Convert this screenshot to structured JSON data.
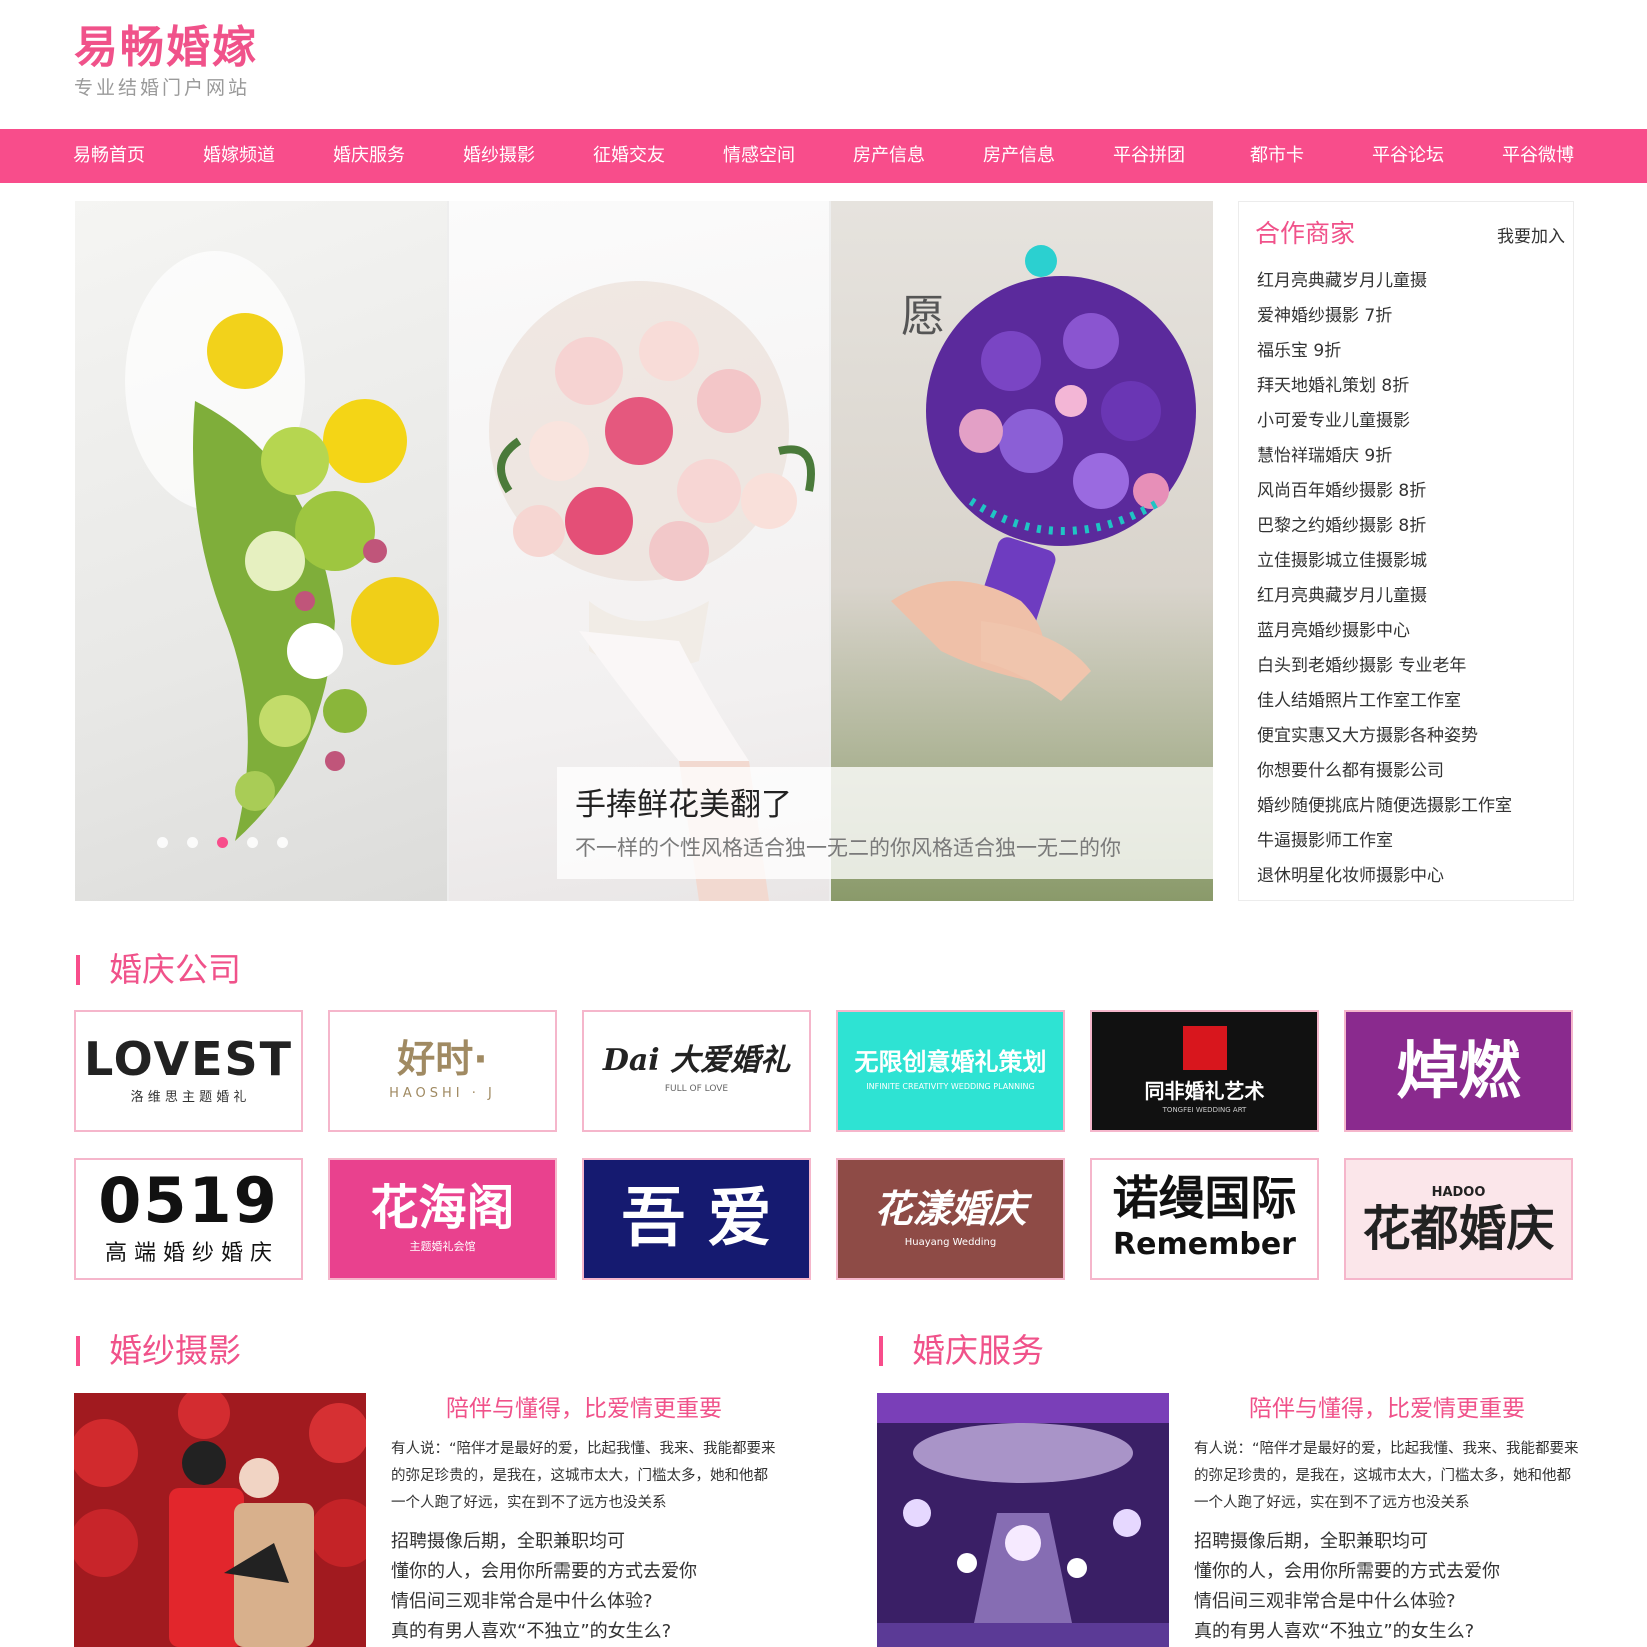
{
  "logo": {
    "title": "易畅婚嫁",
    "subtitle": "专业结婚门户网站"
  },
  "nav": [
    "易畅首页",
    "婚嫁频道",
    "婚庆服务",
    "婚纱摄影",
    "征婚交友",
    "情感空间",
    "房产信息",
    "房产信息",
    "平谷拼团",
    "都市卡",
    "平谷论坛",
    "平谷微博"
  ],
  "hero": {
    "title": "手捧鲜花美翻了",
    "desc": "不一样的个性风格适合独一无二的你风格适合独一无二的你",
    "panel3_text": "愿",
    "active_dot": 3
  },
  "partners": {
    "title": "合作商家",
    "join": "我要加入",
    "items": [
      "红月亮典藏岁月儿童摄",
      "爱神婚纱摄影 7折",
      "福乐宝 9折",
      "拜天地婚礼策划 8折",
      "小可爱专业儿童摄影",
      "慧怡祥瑞婚庆 9折",
      "风尚百年婚纱摄影 8折",
      "巴黎之约婚纱摄影 8折",
      "立佳摄影城立佳摄影城",
      "红月亮典藏岁月儿童摄",
      "蓝月亮婚纱摄影中心",
      "白头到老婚纱摄影 专业老年",
      "佳人结婚照片工作室工作室",
      "便宜实惠又大方摄影各种姿势",
      "你想要什么都有摄影公司",
      "婚纱随便挑底片随便选摄影工作室",
      "牛逼摄影师工作室",
      "退休明星化妆师摄影中心"
    ]
  },
  "companies_section": {
    "title": "婚庆公司"
  },
  "companies": [
    {
      "main": "LOVEST",
      "sub": "洛 维 思 主 题 婚 礼",
      "bg": "#ffffff",
      "color": "#222222",
      "icon": "lovest-logo"
    },
    {
      "main": "好时·",
      "sub": "HAOSHI · J",
      "bg": "#ffffff",
      "color": "#a08a62",
      "icon": "haoshi-logo"
    },
    {
      "main": "Dai 大爱婚礼",
      "sub": "FULL OF LOVE",
      "bg": "#ffffff",
      "color": "#222222",
      "icon": "daai-logo"
    },
    {
      "main": "无限创意婚礼策划",
      "sub": "INFINITE CREATIVITY WEDDING PLANNING",
      "bg": "#2ee3d3",
      "color": "#ffffff",
      "icon": "wuxian-logo"
    },
    {
      "main": "同非婚礼艺术",
      "sub": "TONGFEI WEDDING ART",
      "bg": "#111111",
      "color": "#ffffff",
      "icon": "tongfei-logo"
    },
    {
      "main": "焯燃",
      "sub": "",
      "bg": "#8a2a8e",
      "color": "#ffffff",
      "icon": "zhuoran-logo"
    },
    {
      "main": "0519",
      "sub": "高 端 婚 纱 婚 庆",
      "bg": "#ffffff",
      "color": "#111111",
      "icon": "0519-logo"
    },
    {
      "main": "花海阁",
      "sub": "主题婚礼会馆",
      "bg": "#e9418e",
      "color": "#ffffff",
      "icon": "huahaige-logo"
    },
    {
      "main": "吾 爱",
      "sub": "",
      "bg": "#151a70",
      "color": "#ffffff",
      "icon": "wuai-logo"
    },
    {
      "main": "花漾婚庆",
      "sub": "Huayang Wedding",
      "bg": "#8e4b46",
      "color": "#ffffff",
      "icon": "huayang-logo"
    },
    {
      "main": "诺缦国际",
      "sub": "Remember",
      "bg": "#ffffff",
      "color": "#111111",
      "icon": "nuoman-logo"
    },
    {
      "main": "花都婚庆",
      "sub": "HADOO",
      "bg": "#fbe6ea",
      "color": "#222222",
      "icon": "huadu-logo"
    }
  ],
  "photo_section": {
    "title": "婚纱摄影",
    "article_title": "陪伴与懂得，比爱情更重要",
    "paragraph": "有人说：“陪伴才是最好的爱，比起我懂、我来、我能都要来的弥足珍贵的，是我在，这城市太大，门槛太多，她和他都一个人跑了好远，实在到不了远方也没关系",
    "lines": [
      "招聘摄像后期，全职兼职均可",
      "懂你的人，会用你所需要的方式去爱你",
      "情侣间三观非常合是中什么体验?",
      "真的有男人喜欢“不独立”的女生么?"
    ]
  },
  "service_section": {
    "title": "婚庆服务",
    "article_title": "陪伴与懂得，比爱情更重要",
    "paragraph": "有人说：“陪伴才是最好的爱，比起我懂、我来、我能都要来的弥足珍贵的，是我在，这城市太大，门槛太多，她和他都一个人跑了好远，实在到不了远方也没关系",
    "lines": [
      "招聘摄像后期，全职兼职均可",
      "懂你的人，会用你所需要的方式去爱你",
      "情侣间三观非常合是中什么体验?",
      "真的有男人喜欢“不独立”的女生么?"
    ]
  },
  "colors": {
    "brand": "#f84d8b",
    "brand_text": "#f0528a",
    "logo_border": "#f5b6cb"
  }
}
